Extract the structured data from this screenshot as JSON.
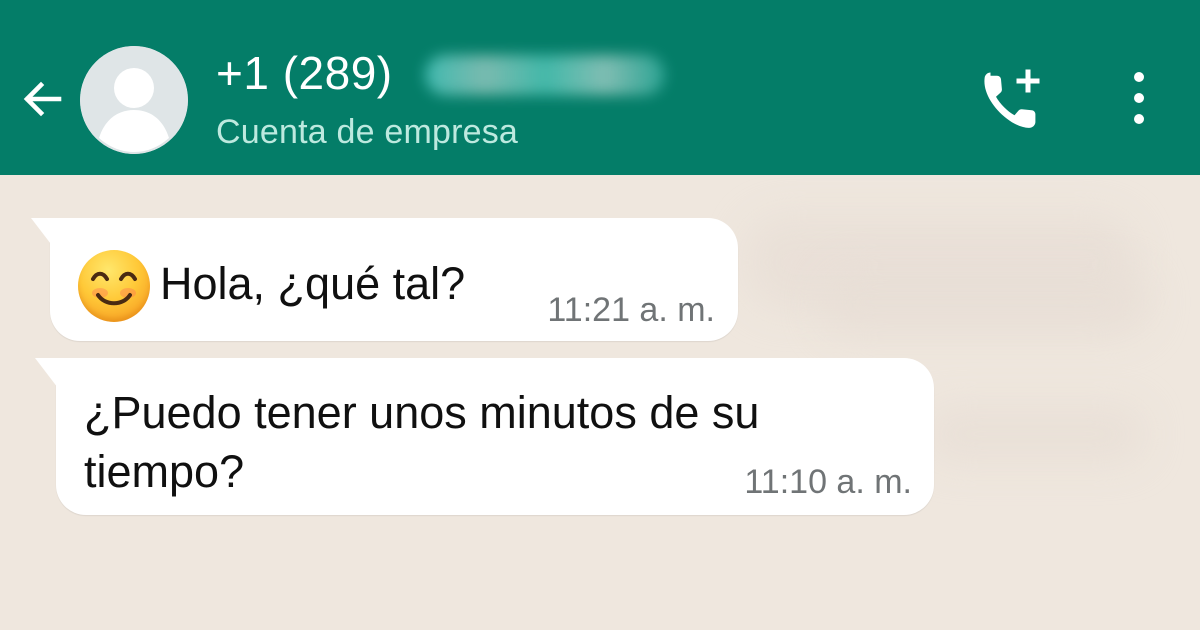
{
  "colors": {
    "header_background": "#047d68",
    "chat_background": "#efe7de",
    "message_background": "#ffffff",
    "subtitle_text": "#bde9df",
    "timestamp_text": "#707476"
  },
  "header": {
    "back_icon": "back-arrow-icon",
    "avatar_icon": "person-avatar-icon",
    "contact_number_visible": "+1 (289)",
    "contact_type": "Cuenta de empresa",
    "actions": {
      "call_add_icon": "phone-plus-icon",
      "menu_icon": "vertical-dots-icon"
    }
  },
  "messages": [
    {
      "emoji": "smiling-face-emoji",
      "text": "Hola, ¿qué tal?",
      "time": "11:21 a. m."
    },
    {
      "text": "¿Puedo tener unos minutos de su tiempo?",
      "time": "11:10 a. m."
    }
  ]
}
